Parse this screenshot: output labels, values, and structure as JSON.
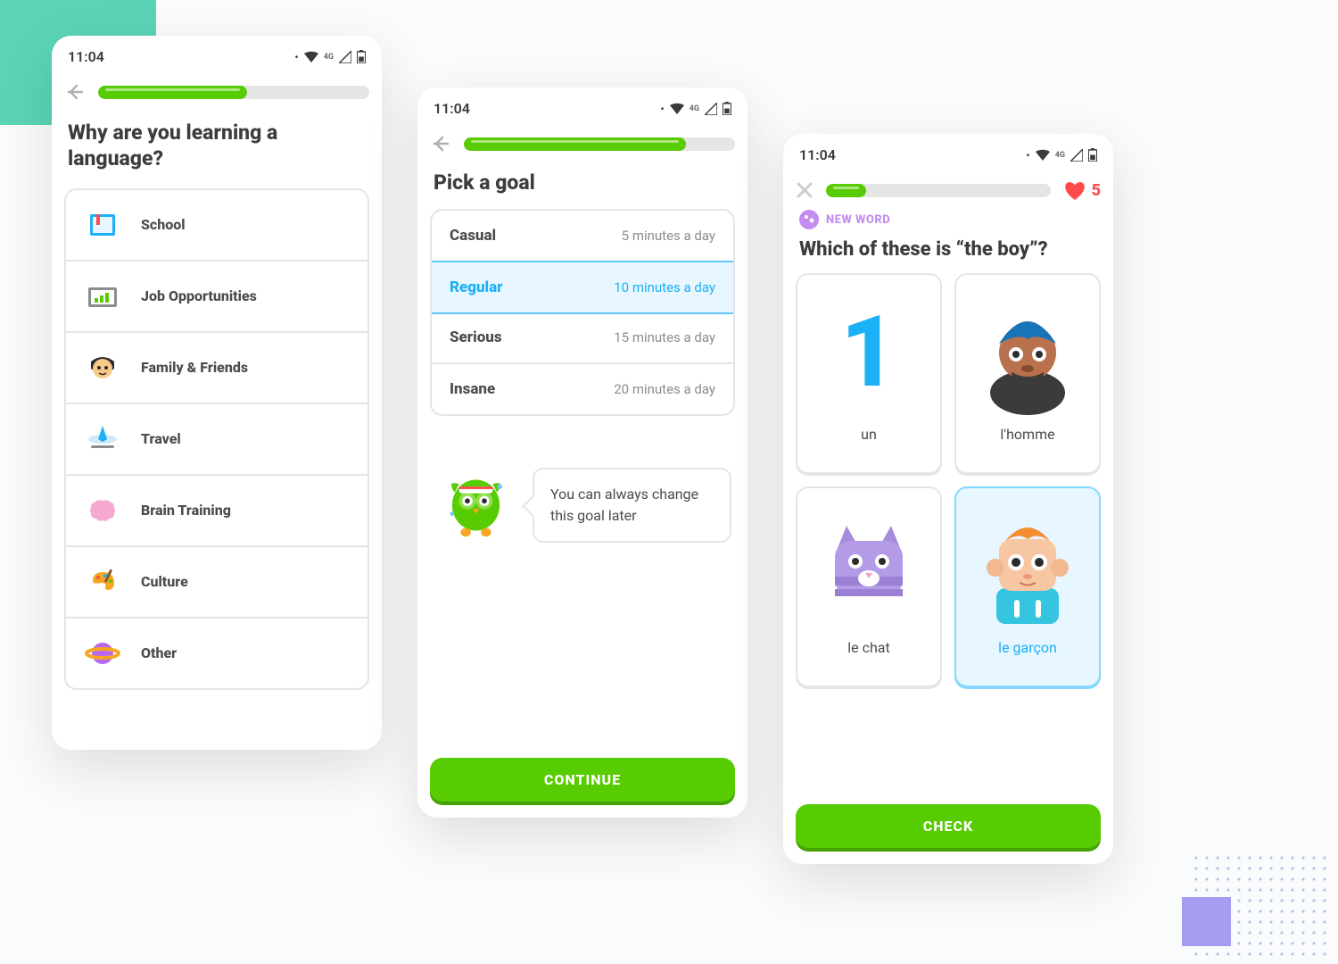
{
  "status": {
    "time": "11:04",
    "network": "4G"
  },
  "screen1": {
    "progress_pct": 55,
    "heading": "Why are you learning a language?",
    "items": [
      {
        "label": "School",
        "icon": "book"
      },
      {
        "label": "Job Opportunities",
        "icon": "chart"
      },
      {
        "label": "Family & Friends",
        "icon": "person"
      },
      {
        "label": "Travel",
        "icon": "plane"
      },
      {
        "label": "Brain Training",
        "icon": "brain"
      },
      {
        "label": "Culture",
        "icon": "palette"
      },
      {
        "label": "Other",
        "icon": "planet"
      }
    ]
  },
  "screen2": {
    "progress_pct": 82,
    "heading": "Pick a goal",
    "goals": [
      {
        "name": "Casual",
        "desc": "5 minutes a day",
        "selected": false
      },
      {
        "name": "Regular",
        "desc": "10 minutes a day",
        "selected": true
      },
      {
        "name": "Serious",
        "desc": "15 minutes a day",
        "selected": false
      },
      {
        "name": "Insane",
        "desc": "20 minutes a day",
        "selected": false
      }
    ],
    "tip": "You can always change this goal later",
    "cta": "CONTINUE"
  },
  "screen3": {
    "progress_pct": 18,
    "hearts": "5",
    "badge": "NEW WORD",
    "question": "Which of these is “the boy”?",
    "cards": [
      {
        "label": "un",
        "selected": false
      },
      {
        "label": "l'homme",
        "selected": false
      },
      {
        "label": "le chat",
        "selected": false
      },
      {
        "label": "le garçon",
        "selected": true
      }
    ],
    "cta": "CHECK"
  }
}
